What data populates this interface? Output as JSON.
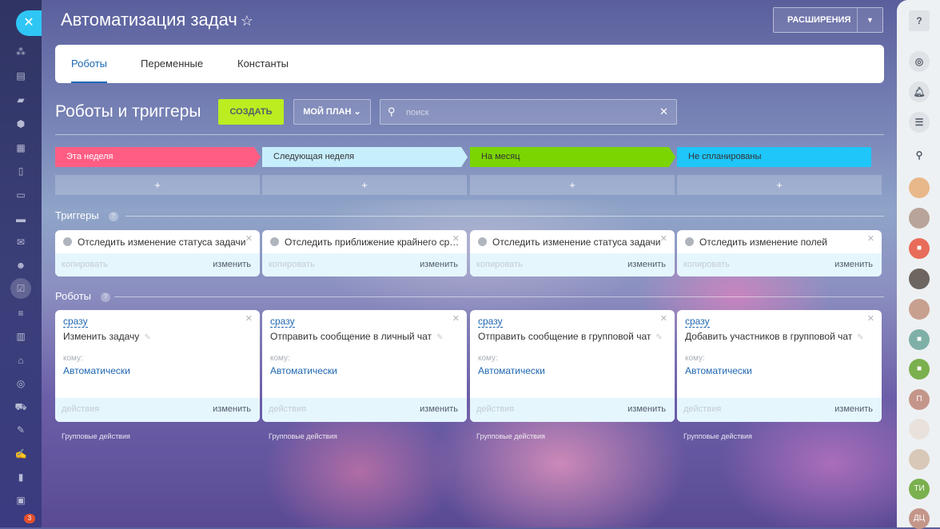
{
  "header": {
    "title": "Автоматизация задач",
    "extensions_label": "РАСШИРЕНИЯ"
  },
  "tabs": [
    {
      "label": "Роботы",
      "active": true
    },
    {
      "label": "Переменные"
    },
    {
      "label": "Константы"
    }
  ],
  "section_title": "Роботы и триггеры",
  "toolbar": {
    "create_label": "СОЗДАТЬ",
    "plan_label": "МОЙ ПЛАН",
    "search_placeholder": "поиск"
  },
  "stages": [
    {
      "label": "Эта неделя",
      "color": "#ff5d84"
    },
    {
      "label": "Следующая неделя",
      "color": "#c7eefc"
    },
    {
      "label": "На месяц",
      "color": "#7bd500"
    },
    {
      "label": "Не спланированы",
      "color": "#1ec6fa"
    }
  ],
  "add_label": "+",
  "triggers": {
    "title": "Триггеры",
    "copy_label": "копировать",
    "edit_label": "изменить",
    "items": [
      "Отследить изменение статуса задачи",
      "Отследить приближение крайнего срока",
      "Отследить изменение статуса задачи",
      "Отследить изменение полей"
    ]
  },
  "robots": {
    "title": "Роботы",
    "actions_label": "действия",
    "edit_label": "изменить",
    "to_label": "кому:",
    "group_label": "Групповые действия",
    "items": [
      {
        "when": "сразу",
        "name": "Изменить задачу",
        "to": "Автоматически"
      },
      {
        "when": "сразу",
        "name": "Отправить сообщение в личный чат",
        "to": "Автоматически"
      },
      {
        "when": "сразу",
        "name": "Отправить сообщение в групповой чат",
        "to": "Автоматически"
      },
      {
        "when": "сразу",
        "name": "Добавить участников в групповой чат",
        "to": "Автоматически"
      }
    ]
  },
  "left_nav": {
    "badge": "3"
  },
  "right_panel": {
    "avatars": [
      "П",
      "ТИ",
      "ДЦ"
    ]
  }
}
